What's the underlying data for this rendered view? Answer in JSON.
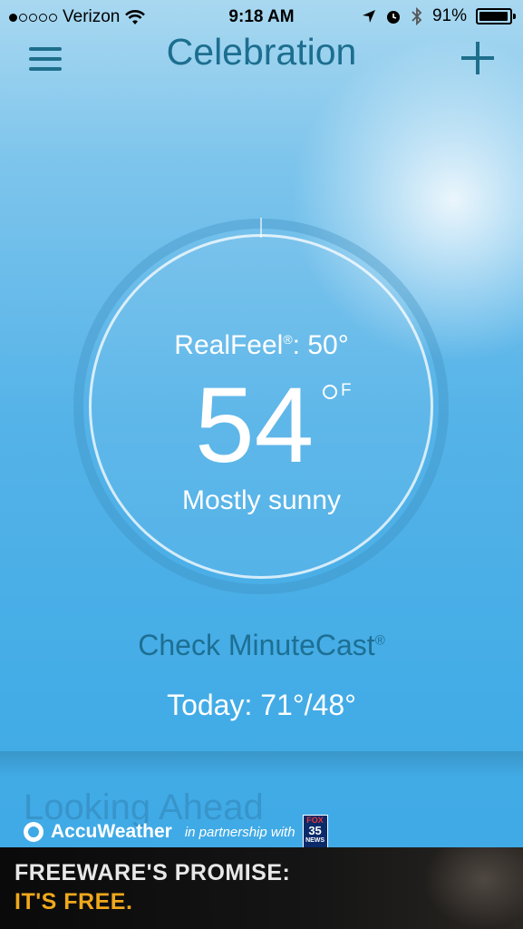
{
  "status_bar": {
    "carrier": "Verizon",
    "time": "9:18 AM",
    "battery": "91%"
  },
  "header": {
    "title": "Celebration"
  },
  "current": {
    "realfeel_label": "RealFeel",
    "realfeel_mark": "®",
    "realfeel_value": ": 50°",
    "temperature": "54",
    "unit": "F",
    "condition": "Mostly sunny"
  },
  "minutecast": {
    "label": "Check MinuteCast",
    "mark": "®"
  },
  "today": {
    "label": "Today: 71°/48°"
  },
  "section": {
    "looking_ahead": "Looking Ahead"
  },
  "footer": {
    "brand": "AccuWeather",
    "partner_text": "in partnership with",
    "fox_line1": "FOX",
    "fox_line2": "35",
    "fox_line3": "NEWS"
  },
  "ad": {
    "line1": "FREEWARE'S PROMISE:",
    "line2": "IT'S FREE."
  },
  "colors": {
    "accent": "#1c6e8f",
    "ad_highlight": "#f0a81c"
  }
}
